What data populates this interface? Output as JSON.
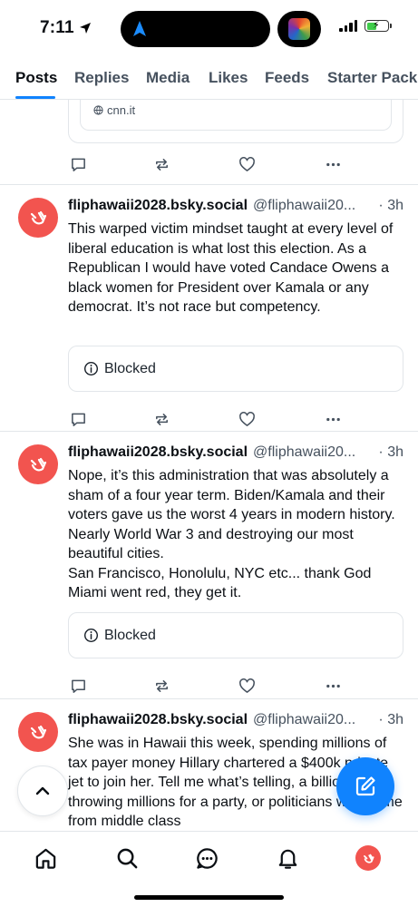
{
  "status_bar": {
    "time": "7:11"
  },
  "tabs": [
    {
      "label": "Posts",
      "active": true
    },
    {
      "label": "Replies"
    },
    {
      "label": "Media"
    },
    {
      "label": "Likes"
    },
    {
      "label": "Feeds"
    },
    {
      "label": "Starter Packs"
    }
  ],
  "partial_embed": {
    "link": "cnn.it"
  },
  "posts": [
    {
      "display_name": "fliphawaii2028.bsky.social",
      "handle": "@fliphawaii20...",
      "time": "· 3h",
      "text": "This warped victim mindset taught at every level of liberal education is what lost this election. As a Republican I  would have voted Candace Owens a black women for President over Kamala or any democrat. It’s not race but competency.",
      "embed": "Blocked"
    },
    {
      "display_name": "fliphawaii2028.bsky.social",
      "handle": "@fliphawaii20...",
      "time": "· 3h",
      "text": "Nope, it’s this administration that was absolutely a sham of a four year term. Biden/Kamala and their voters gave us the worst 4 years in modern history. Nearly World War 3 and destroying our most beautiful cities.\nSan Francisco, Honolulu, NYC etc... thank God Miami went red, they get it.",
      "embed": "Blocked"
    },
    {
      "display_name": "fliphawaii2028.bsky.social",
      "handle": "@fliphawaii20...",
      "time": "· 3h",
      "text": "She was in Hawaii this week, spending millions of tax payer money Hillary chartered a $400k private jet to join her. Tell me what’s telling, a billionaire throwing millions for a party, or politicians who come from middle class"
    }
  ],
  "colors": {
    "accent": "#1083fe",
    "avatar": "#f2544f",
    "text_muted": "#46515e",
    "border": "#e2e6ea"
  }
}
